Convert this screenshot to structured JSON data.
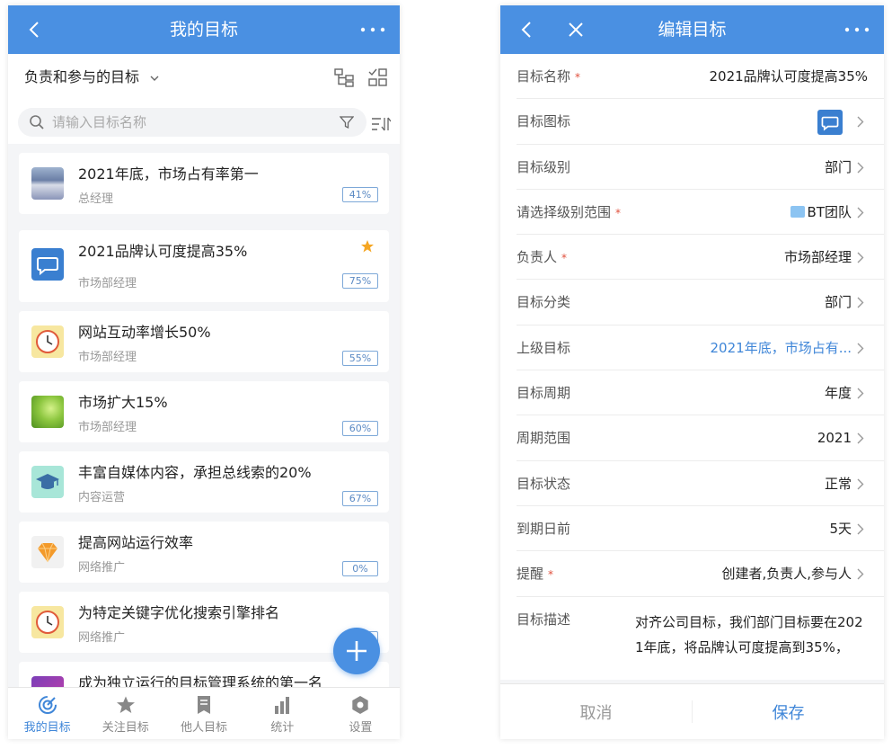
{
  "left": {
    "header": {
      "title": "我的目标"
    },
    "filter": {
      "scope_label": "负责和参与的目标"
    },
    "search": {
      "placeholder": "请输入目标名称"
    },
    "goals": [
      {
        "title": "2021年底，市场占有率第一",
        "owner": "总经理",
        "progress": "41%",
        "starred": false
      },
      {
        "title": "2021品牌认可度提高35%",
        "owner": "市场部经理",
        "progress": "75%",
        "starred": true
      },
      {
        "title": "网站互动率增长50%",
        "owner": "市场部经理",
        "progress": "55%",
        "starred": false
      },
      {
        "title": "市场扩大15%",
        "owner": "市场部经理",
        "progress": "60%",
        "starred": false
      },
      {
        "title": "丰富自媒体内容，承担总线索的20%",
        "owner": "内容运营",
        "progress": "67%",
        "starred": false
      },
      {
        "title": "提高网站运行效率",
        "owner": "网络推广",
        "progress": "0%",
        "starred": false
      },
      {
        "title": "为特定关键字优化搜索引擎排名",
        "owner": "网络推广",
        "progress": "",
        "starred": false
      },
      {
        "title": "成为独立运行的目标管理系统的第一名",
        "owner": "",
        "progress": "",
        "starred": false
      }
    ],
    "tabs": [
      {
        "label": "我的目标",
        "icon": "target-icon",
        "active": true
      },
      {
        "label": "关注目标",
        "icon": "star-icon",
        "active": false
      },
      {
        "label": "他人目标",
        "icon": "document-icon",
        "active": false
      },
      {
        "label": "统计",
        "icon": "bar-chart-icon",
        "active": false
      },
      {
        "label": "设置",
        "icon": "gear-icon",
        "active": false
      }
    ]
  },
  "right": {
    "header": {
      "title": "编辑目标"
    },
    "fields": {
      "name": {
        "label": "目标名称",
        "value": "2021品牌认可度提高35%",
        "required": "*"
      },
      "icon": {
        "label": "目标图标"
      },
      "level": {
        "label": "目标级别",
        "value": "部门"
      },
      "scope": {
        "label": "请选择级别范围",
        "value": "BT团队",
        "required": "*"
      },
      "owner": {
        "label": "负责人",
        "value": "市场部经理",
        "required": "*"
      },
      "category": {
        "label": "目标分类",
        "value": "部门"
      },
      "parent": {
        "label": "上级目标",
        "value": "2021年底，市场占有..."
      },
      "period": {
        "label": "目标周期",
        "value": "年度"
      },
      "range": {
        "label": "周期范围",
        "value": "2021"
      },
      "status": {
        "label": "目标状态",
        "value": "正常"
      },
      "due": {
        "label": "到期日前",
        "value": "5天"
      },
      "remind": {
        "label": "提醒",
        "value": "创建者,负责人,参与人",
        "required": "*"
      },
      "description": {
        "label": "目标描述",
        "value": "对齐公司目标，我们部门目标要在2021年底，将品牌认可度提高到35%，"
      }
    },
    "footer": {
      "cancel_label": "取消",
      "save_label": "保存"
    }
  },
  "colors": {
    "primary": "#4a90e2",
    "link": "#3f86d8",
    "required": "#e0503c",
    "star": "#f5a623"
  }
}
